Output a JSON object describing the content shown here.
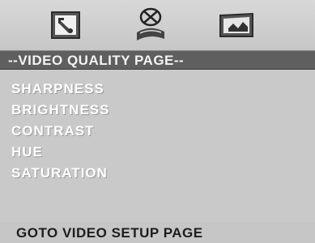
{
  "icons": {
    "tab_general": "general-setup-icon",
    "tab_audio": "audio-setup-icon",
    "tab_video": "video-setup-icon"
  },
  "title": "--VIDEO  QUALITY PAGE--",
  "menu": {
    "items": [
      {
        "label": "SHARPNESS"
      },
      {
        "label": "BRIGHTNESS"
      },
      {
        "label": "CONTRAST"
      },
      {
        "label": "HUE"
      },
      {
        "label": "SATURATION"
      }
    ]
  },
  "footer": {
    "label": "GOTO VIDEO SETUP PAGE"
  },
  "colors": {
    "background": "#c9c9c9",
    "title_bar": "#5f5f5f",
    "menu_text": "#ffffff",
    "footer_text": "#1d1d1d"
  }
}
